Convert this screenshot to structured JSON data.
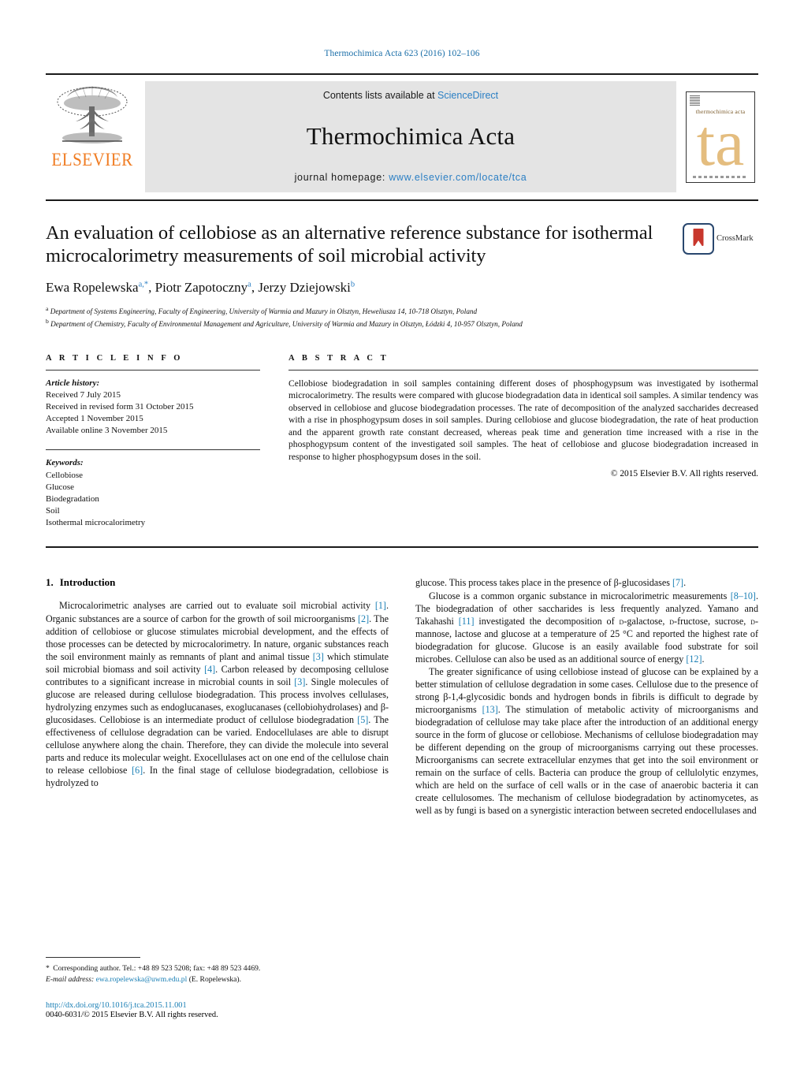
{
  "running_head": "Thermochimica Acta 623 (2016) 102–106",
  "masthead": {
    "publisher": "ELSEVIER",
    "contents_prefix": "Contents lists available at ",
    "contents_link": "ScienceDirect",
    "journal_title": "Thermochimica Acta",
    "homepage_prefix": "journal homepage: ",
    "homepage_url": "www.elsevier.com/locate/tca",
    "cover_title": "thermochimica acta",
    "cover_mark": "ta"
  },
  "article": {
    "title": "An evaluation of cellobiose as an alternative reference substance for isothermal microcalorimetry measurements of soil microbial activity",
    "authors_html": "Ewa Ropelewska<sup>a,*</sup>, Piotr Zapotoczny<sup>a</sup>, Jerzy Dziejowski<sup>b</sup>",
    "affiliation_a": "Department of Systems Engineering, Faculty of Engineering, University of Warmia and Mazury in Olsztyn, Heweliusza 14, 10-718 Olsztyn, Poland",
    "affiliation_b": "Department of Chemistry, Faculty of Environmental Management and Agriculture, University of Warmia and Mazury in Olsztyn, Łódzki 4, 10-957 Olsztyn, Poland",
    "crossmark_label": "CrossMark"
  },
  "info": {
    "heading": "A R T I C L E    I N F O",
    "history_label": "Article history:",
    "history": [
      "Received 7 July 2015",
      "Received in revised form 31 October 2015",
      "Accepted 1 November 2015",
      "Available online 3 November 2015"
    ],
    "keywords_label": "Keywords:",
    "keywords": [
      "Cellobiose",
      "Glucose",
      "Biodegradation",
      "Soil",
      "Isothermal microcalorimetry"
    ]
  },
  "abstract": {
    "heading": "A B S T R A C T",
    "text": "Cellobiose biodegradation in soil samples containing different doses of phosphogypsum was investigated by isothermal microcalorimetry. The results were compared with glucose biodegradation data in identical soil samples. A similar tendency was observed in cellobiose and glucose biodegradation processes. The rate of decomposition of the analyzed saccharides decreased with a rise in phosphogypsum doses in soil samples. During cellobiose and glucose biodegradation, the rate of heat production and the apparent growth rate constant decreased, whereas peak time and generation time increased with a rise in the phosphogypsum content of the investigated soil samples. The heat of cellobiose and glucose biodegradation increased in response to higher phosphogypsum doses in the soil.",
    "copyright": "© 2015 Elsevier B.V. All rights reserved."
  },
  "introduction": {
    "number": "1.",
    "heading": "Introduction",
    "left_paragraph_html": "Microcalorimetric analyses are carried out to evaluate soil microbial activity <span class=\"ref\">[1]</span>. Organic substances are a source of carbon for the growth of soil microorganisms <span class=\"ref\">[2]</span>. The addition of cellobiose or glucose stimulates microbial development, and the effects of those processes can be detected by microcalorimetry. In nature, organic substances reach the soil environment mainly as remnants of plant and animal tissue <span class=\"ref\">[3]</span> which stimulate soil microbial biomass and soil activity <span class=\"ref\">[4]</span>. Carbon released by decomposing cellulose contributes to a significant increase in microbial counts in soil <span class=\"ref\">[3]</span>. Single molecules of glucose are released during cellulose biodegradation. This process involves cellulases, hydrolyzing enzymes such as endoglucanases, exoglucanases (cellobiohydrolases) and β-glucosidases. Cellobiose is an intermediate product of cellulose biodegradation <span class=\"ref\">[5]</span>. The effectiveness of cellulose degradation can be varied. Endocellulases are able to disrupt cellulose anywhere along the chain. Therefore, they can divide the molecule into several parts and reduce its molecular weight. Exocellulases act on one end of the cellulose chain to release cellobiose <span class=\"ref\">[6]</span>. In the final stage of cellulose biodegradation, cellobiose is hydrolyzed to",
    "right_continuation_html": "glucose. This process takes place in the presence of β-glucosidases <span class=\"ref\">[7]</span>.",
    "right_paragraph1_html": "Glucose is a common organic substance in microcalorimetric measurements <span class=\"ref\">[8–10]</span>. The biodegradation of other saccharides is less frequently analyzed. Yamano and Takahashi <span class=\"ref\">[11]</span> investigated the decomposition of <span class=\"small-caps\">d</span>-galactose, <span class=\"small-caps\">d</span>-fructose, sucrose, <span class=\"small-caps\">d</span>-mannose, lactose and glucose at a temperature of 25 °C and reported the highest rate of biodegradation for glucose. Glucose is an easily available food substrate for soil microbes. Cellulose can also be used as an additional source of energy <span class=\"ref\">[12]</span>.",
    "right_paragraph2_html": "The greater significance of using cellobiose instead of glucose can be explained by a better stimulation of cellulose degradation in some cases. Cellulose due to the presence of strong β-1,4-glycosidic bonds and hydrogen bonds in fibrils is difficult to degrade by microorganisms <span class=\"ref\">[13]</span>. The stimulation of metabolic activity of microorganisms and biodegradation of cellulose may take place after the introduction of an additional energy source in the form of glucose or cellobiose. Mechanisms of cellulose biodegradation may be different depending on the group of microorganisms carrying out these processes. Microorganisms can secrete extracellular enzymes that get into the soil environment or remain on the surface of cells. Bacteria can produce the group of cellulolytic enzymes, which are held on the surface of cell walls or in the case of anaerobic bacteria it can create cellulosomes. The mechanism of cellulose biodegradation by actinomycetes, as well as by fungi is based on a synergistic interaction between secreted endocellulases and"
  },
  "footnote": {
    "corresponding_html": "<span class=\"star\">*</span>  Corresponding author. Tel.: +48 89 523 5208; fax: +48 89 523 4469.",
    "email_label": "E-mail address:",
    "email": "ewa.ropelewska@uwm.edu.pl",
    "email_suffix": "(E. Ropelewska).",
    "doi": "http://dx.doi.org/10.1016/j.tca.2015.11.001",
    "issn_line": "0040-6031/© 2015 Elsevier B.V. All rights reserved."
  }
}
